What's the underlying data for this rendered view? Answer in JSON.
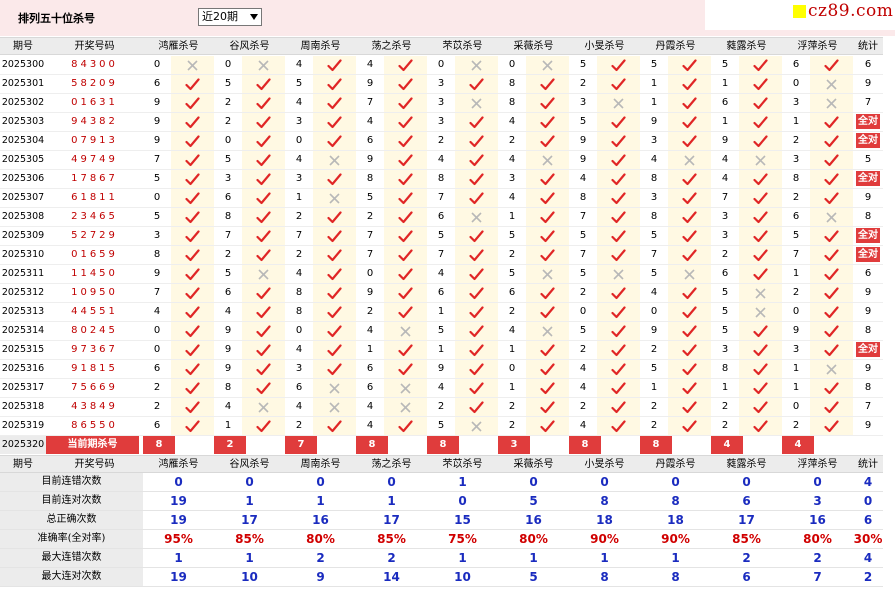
{
  "top": {
    "title": "排列五十位杀号",
    "period_select": "近20期"
  },
  "watermark": {
    "text": "cz89.com"
  },
  "header": {
    "id": "期号",
    "num": "开奖号码",
    "methods": [
      "鸿雁杀号",
      "谷风杀号",
      "周南杀号",
      "荡之杀号",
      "芣苡杀号",
      "采薇杀号",
      "小旻杀号",
      "丹霞杀号",
      "蕤露杀号",
      "浮萍杀号"
    ],
    "stat": "统计"
  },
  "rows": [
    {
      "id": "2025300",
      "num": "84300",
      "v": [
        "0",
        "0",
        "4",
        "4",
        "0",
        "0",
        "5",
        "5",
        "5",
        "6"
      ],
      "ok": [
        0,
        0,
        1,
        1,
        0,
        0,
        1,
        1,
        1,
        1
      ],
      "stat": "6"
    },
    {
      "id": "2025301",
      "num": "58209",
      "v": [
        "6",
        "5",
        "5",
        "9",
        "3",
        "8",
        "2",
        "1",
        "1",
        "0"
      ],
      "ok": [
        1,
        1,
        1,
        1,
        1,
        1,
        1,
        1,
        1,
        0
      ],
      "stat": "9"
    },
    {
      "id": "2025302",
      "num": "01631",
      "v": [
        "9",
        "2",
        "4",
        "7",
        "3",
        "8",
        "3",
        "1",
        "6",
        "3"
      ],
      "ok": [
        1,
        1,
        1,
        1,
        0,
        1,
        0,
        1,
        1,
        0
      ],
      "stat": "7"
    },
    {
      "id": "2025303",
      "num": "94382",
      "v": [
        "9",
        "2",
        "3",
        "4",
        "3",
        "4",
        "5",
        "9",
        "1",
        "1"
      ],
      "ok": [
        1,
        1,
        1,
        1,
        1,
        1,
        1,
        1,
        1,
        1
      ],
      "stat": "全对"
    },
    {
      "id": "2025304",
      "num": "07913",
      "v": [
        "9",
        "0",
        "0",
        "6",
        "2",
        "2",
        "9",
        "3",
        "9",
        "2"
      ],
      "ok": [
        1,
        1,
        1,
        1,
        1,
        1,
        1,
        1,
        1,
        1
      ],
      "stat": "全对"
    },
    {
      "id": "2025305",
      "num": "49749",
      "v": [
        "7",
        "5",
        "4",
        "9",
        "4",
        "4",
        "9",
        "4",
        "4",
        "3"
      ],
      "ok": [
        1,
        1,
        0,
        1,
        1,
        0,
        1,
        0,
        0,
        1
      ],
      "stat": "5"
    },
    {
      "id": "2025306",
      "num": "17867",
      "v": [
        "5",
        "3",
        "3",
        "8",
        "8",
        "3",
        "4",
        "8",
        "4",
        "8"
      ],
      "ok": [
        1,
        1,
        1,
        1,
        1,
        1,
        1,
        1,
        1,
        1
      ],
      "stat": "全对"
    },
    {
      "id": "2025307",
      "num": "61811",
      "v": [
        "0",
        "6",
        "1",
        "5",
        "7",
        "4",
        "8",
        "3",
        "7",
        "2"
      ],
      "ok": [
        1,
        1,
        0,
        1,
        1,
        1,
        1,
        1,
        1,
        1
      ],
      "stat": "9"
    },
    {
      "id": "2025308",
      "num": "23465",
      "v": [
        "5",
        "8",
        "2",
        "2",
        "6",
        "1",
        "7",
        "8",
        "3",
        "6"
      ],
      "ok": [
        1,
        1,
        1,
        1,
        0,
        1,
        1,
        1,
        1,
        0
      ],
      "stat": "8"
    },
    {
      "id": "2025309",
      "num": "52729",
      "v": [
        "3",
        "7",
        "7",
        "7",
        "5",
        "5",
        "5",
        "5",
        "3",
        "5"
      ],
      "ok": [
        1,
        1,
        1,
        1,
        1,
        1,
        1,
        1,
        1,
        1
      ],
      "stat": "全对"
    },
    {
      "id": "2025310",
      "num": "01659",
      "v": [
        "8",
        "2",
        "2",
        "7",
        "7",
        "2",
        "7",
        "7",
        "2",
        "7"
      ],
      "ok": [
        1,
        1,
        1,
        1,
        1,
        1,
        1,
        1,
        1,
        1
      ],
      "stat": "全对"
    },
    {
      "id": "2025311",
      "num": "11450",
      "v": [
        "9",
        "5",
        "4",
        "0",
        "4",
        "5",
        "5",
        "5",
        "6",
        "1"
      ],
      "ok": [
        1,
        0,
        1,
        1,
        1,
        0,
        0,
        0,
        1,
        1
      ],
      "stat": "6"
    },
    {
      "id": "2025312",
      "num": "10950",
      "v": [
        "7",
        "6",
        "8",
        "9",
        "6",
        "6",
        "2",
        "4",
        "5",
        "2"
      ],
      "ok": [
        1,
        1,
        1,
        1,
        1,
        1,
        1,
        1,
        0,
        1
      ],
      "stat": "9"
    },
    {
      "id": "2025313",
      "num": "44551",
      "v": [
        "4",
        "4",
        "8",
        "2",
        "1",
        "2",
        "0",
        "0",
        "5",
        "0"
      ],
      "ok": [
        1,
        1,
        1,
        1,
        1,
        1,
        1,
        1,
        0,
        1
      ],
      "stat": "9"
    },
    {
      "id": "2025314",
      "num": "80245",
      "v": [
        "0",
        "9",
        "0",
        "4",
        "5",
        "4",
        "5",
        "9",
        "5",
        "9"
      ],
      "ok": [
        1,
        1,
        1,
        0,
        1,
        0,
        1,
        1,
        1,
        1
      ],
      "stat": "8"
    },
    {
      "id": "2025315",
      "num": "97367",
      "v": [
        "0",
        "9",
        "4",
        "1",
        "1",
        "1",
        "2",
        "2",
        "3",
        "3"
      ],
      "ok": [
        1,
        1,
        1,
        1,
        1,
        1,
        1,
        1,
        1,
        1
      ],
      "stat": "全对"
    },
    {
      "id": "2025316",
      "num": "91815",
      "v": [
        "6",
        "9",
        "3",
        "6",
        "9",
        "0",
        "4",
        "5",
        "8",
        "1"
      ],
      "ok": [
        1,
        1,
        1,
        1,
        1,
        1,
        1,
        1,
        1,
        0
      ],
      "stat": "9"
    },
    {
      "id": "2025317",
      "num": "75669",
      "v": [
        "2",
        "8",
        "6",
        "6",
        "4",
        "1",
        "4",
        "1",
        "1",
        "1"
      ],
      "ok": [
        1,
        1,
        0,
        0,
        1,
        1,
        1,
        1,
        1,
        1
      ],
      "stat": "8"
    },
    {
      "id": "2025318",
      "num": "43849",
      "v": [
        "2",
        "4",
        "4",
        "4",
        "2",
        "2",
        "2",
        "2",
        "2",
        "0"
      ],
      "ok": [
        1,
        0,
        0,
        0,
        1,
        1,
        1,
        1,
        1,
        1
      ],
      "stat": "7"
    },
    {
      "id": "2025319",
      "num": "86550",
      "v": [
        "6",
        "1",
        "2",
        "4",
        "5",
        "2",
        "4",
        "2",
        "2",
        "2"
      ],
      "ok": [
        1,
        1,
        1,
        1,
        0,
        1,
        1,
        1,
        1,
        1
      ],
      "stat": "9"
    }
  ],
  "current": {
    "id": "2025320",
    "label": "当前期杀号",
    "values": [
      "8",
      "2",
      "7",
      "8",
      "8",
      "3",
      "8",
      "8",
      "4",
      "4"
    ]
  },
  "stats": [
    {
      "label": "目前连错次数",
      "values": [
        "0",
        "0",
        "0",
        "0",
        "1",
        "0",
        "0",
        "0",
        "0",
        "0"
      ],
      "stat": "4"
    },
    {
      "label": "目前连对次数",
      "values": [
        "19",
        "1",
        "1",
        "1",
        "0",
        "5",
        "8",
        "8",
        "6",
        "3"
      ],
      "stat": "0"
    },
    {
      "label": "总正确次数",
      "values": [
        "19",
        "17",
        "16",
        "17",
        "15",
        "16",
        "18",
        "18",
        "17",
        "16"
      ],
      "stat": "6"
    },
    {
      "label": "准确率(全对率)",
      "values": [
        "95%",
        "85%",
        "80%",
        "85%",
        "75%",
        "80%",
        "90%",
        "90%",
        "85%",
        "80%"
      ],
      "stat": "30%",
      "rate": true
    },
    {
      "label": "最大连错次数",
      "values": [
        "1",
        "1",
        "2",
        "2",
        "1",
        "1",
        "1",
        "1",
        "2",
        "2"
      ],
      "stat": "4"
    },
    {
      "label": "最大连对次数",
      "values": [
        "19",
        "10",
        "9",
        "14",
        "10",
        "5",
        "8",
        "8",
        "6",
        "7"
      ],
      "stat": "2"
    }
  ],
  "colors": {
    "accent_red": "#e03c3c",
    "blue_value": "#1a2bbf",
    "mark_bg": "#fff9e3",
    "header_bg": "#ececec"
  }
}
